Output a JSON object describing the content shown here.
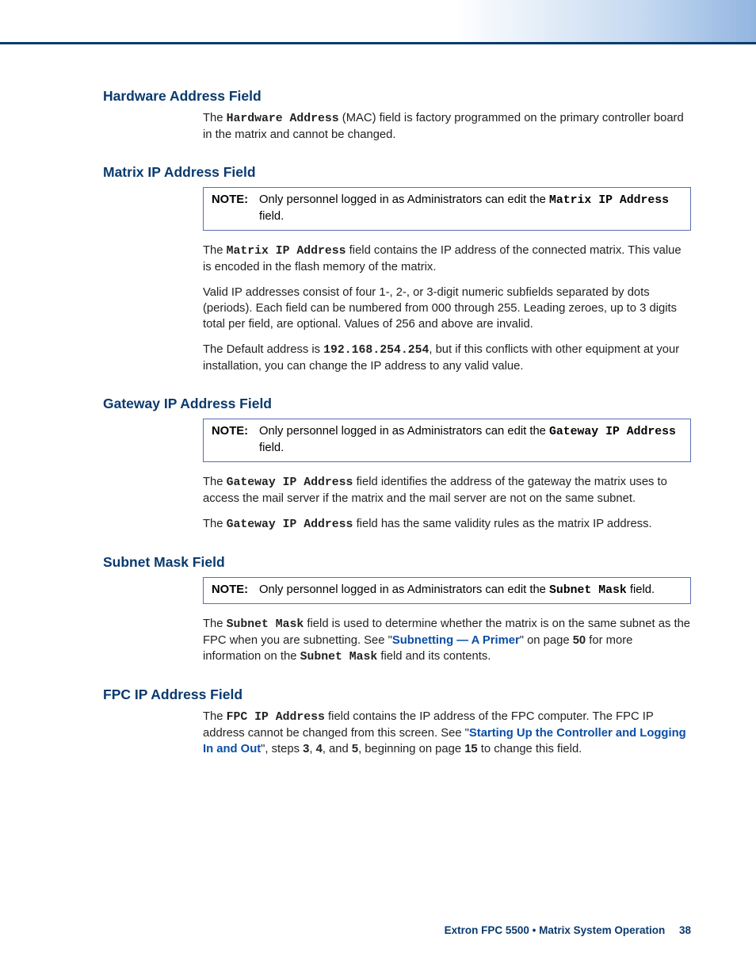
{
  "sections": {
    "hardware": {
      "heading": "Hardware Address Field",
      "p1_a": "The ",
      "p1_mono": "Hardware Address",
      "p1_b": " (MAC) field is factory programmed on the primary controller board in the matrix and cannot be changed."
    },
    "matrix": {
      "heading": "Matrix IP Address Field",
      "note_label": "NOTE:",
      "note_a": "Only personnel logged in as Administrators can edit the ",
      "note_mono": "Matrix IP Address",
      "note_b": " field.",
      "p1_a": "The ",
      "p1_mono": "Matrix IP Address",
      "p1_b": " field contains the IP address of the connected matrix. This value is encoded in the flash memory of the matrix.",
      "p2": "Valid IP addresses consist of four 1-, 2-, or 3-digit numeric subfields separated by dots (periods). Each field can be numbered from 000 through 255. Leading zeroes, up to 3 digits total per field, are optional. Values of 256 and above are invalid.",
      "p3_a": "The Default address is ",
      "p3_mono": "192.168.254.254",
      "p3_b": ", but if this conflicts with other equipment at your installation, you can change the IP address to any valid value."
    },
    "gateway": {
      "heading": "Gateway IP Address Field",
      "note_label": "NOTE:",
      "note_a": "Only personnel logged in as Administrators can edit the ",
      "note_mono": "Gateway IP Address",
      "note_b": " field.",
      "p1_a": "The ",
      "p1_mono": "Gateway IP Address",
      "p1_b": " field identifies the address of the gateway the matrix uses to access the mail server if the matrix and the mail server are not on the same subnet.",
      "p2_a": "The ",
      "p2_mono": "Gateway IP Address",
      "p2_b": " field has the same validity rules as the matrix IP address."
    },
    "subnet": {
      "heading": "Subnet Mask Field",
      "note_label": "NOTE:",
      "note_a": "Only personnel logged in as Administrators can edit the ",
      "note_mono": "Subnet Mask",
      "note_b": " field.",
      "p1_a": "The ",
      "p1_mono": "Subnet Mask",
      "p1_b": " field is used to determine whether the matrix is on the same subnet as the FPC when you are subnetting. See \"",
      "p1_link": "Subnetting — A Primer",
      "p1_c": "\" on page ",
      "p1_page": "50",
      "p1_d": " for more information on the ",
      "p1_mono2": "Subnet Mask",
      "p1_e": " field and its contents."
    },
    "fpc": {
      "heading": "FPC IP Address Field",
      "p1_a": "The ",
      "p1_mono": "FPC IP Address",
      "p1_b": " field contains the IP address of the FPC computer. The FPC IP address cannot be changed from this screen. See \"",
      "p1_link": "Starting Up the Controller and Logging In and Out",
      "p1_c": "\", steps ",
      "p1_s3": "3",
      "p1_s4": "4",
      "p1_s5": "5",
      "p1_d": ", beginning on page ",
      "p1_page": "15",
      "p1_e": " to change this field."
    }
  },
  "footer": {
    "text": "Extron FPC 5500 • Matrix System Operation",
    "page": "38"
  }
}
